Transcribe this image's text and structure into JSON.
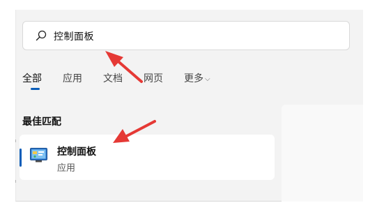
{
  "search": {
    "query": "控制面板"
  },
  "tabs": [
    {
      "label": "全部"
    },
    {
      "label": "应用"
    },
    {
      "label": "文档"
    },
    {
      "label": "网页"
    },
    {
      "label": "更多"
    }
  ],
  "best_match": {
    "title": "最佳匹配",
    "result": {
      "name": "控制面板",
      "type": "应用",
      "icon": "control-panel-icon"
    }
  },
  "annotations": {
    "arrow_color": "#e53935"
  },
  "colors": {
    "accent": "#0a5db8",
    "panel_bg": "#f3f3f3"
  }
}
